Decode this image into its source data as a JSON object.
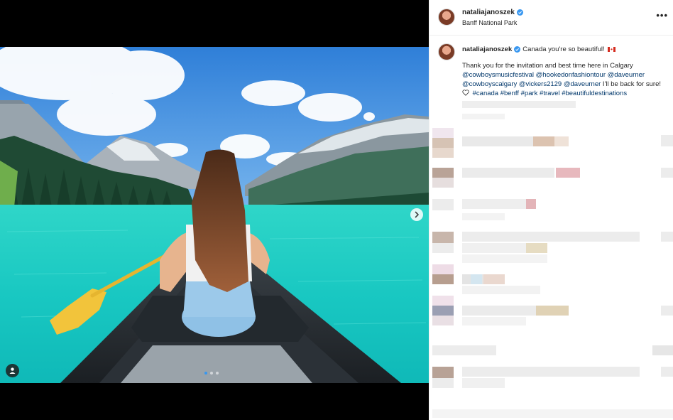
{
  "post": {
    "username": "nataliajanoszek",
    "location": "Banff National Park",
    "more_icon": "more-horizontal-icon",
    "caption_headline": "Canada you're so beautiful!",
    "caption_intro": "Thank you for the invitation and best time here in Calgary",
    "mentions": [
      "@cowboysmusicfestival",
      "@hookedonfashiontour",
      "@daveurner",
      "@cowboyscalgary",
      "@vickers2129",
      "@daveurner"
    ],
    "caption_outro": "I'll be back for sure!",
    "hashtags": [
      "#canada",
      "#benff",
      "#park",
      "#travel",
      "#beautifuldestinations"
    ]
  },
  "carousel": {
    "slide_index": 1,
    "slide_count": 3,
    "next_icon": "chevron-right-icon",
    "tag_icon": "user-tag-icon"
  },
  "colors": {
    "accent": "#3797f0",
    "link": "#00376b",
    "text": "#262626",
    "verified": "#3897f0"
  }
}
